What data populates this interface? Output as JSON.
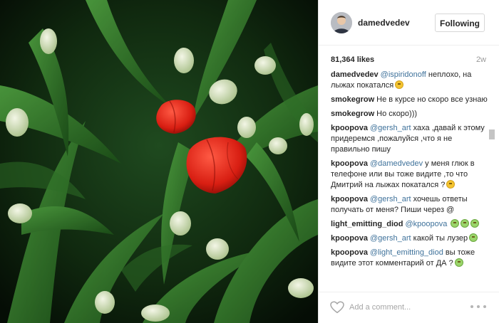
{
  "post": {
    "username": "damedvedev",
    "follow_label": "Following",
    "likes": "81,364 likes",
    "age": "2w",
    "add_comment_placeholder": "Add a comment...",
    "photo_icon": "tulips-photo",
    "avatar_icon": "user-avatar"
  },
  "comments": [
    {
      "author": "damedvedev",
      "mention": "@ispiridonoff",
      "text": " неплохо, на лыжах покатался",
      "emoji": "grin-emoji"
    },
    {
      "author": "smokegrow",
      "mention": "",
      "text": "Не в курсе но скоро все узнаю",
      "emoji": ""
    },
    {
      "author": "smokegrow",
      "mention": "",
      "text": "Но скоро)))",
      "emoji": ""
    },
    {
      "author": "kpoopova",
      "mention": "@gersh_art",
      "text": " хаха ,давай к этому придеремся ,пожалуйся ,что я не правильно пишу",
      "emoji": ""
    },
    {
      "author": "kpoopova",
      "mention": "@damedvedev",
      "text": " у меня глюк в телефоне или вы тоже видите ,то что Дмитрий на лыжах покатался ?",
      "emoji": "grin-emoji"
    },
    {
      "author": "kpoopova",
      "mention": "@gersh_art",
      "text": " хочешь ответы получать от меня? Пиши через @",
      "emoji": ""
    },
    {
      "author": "light_emitting_diod",
      "mention": "@kpoopova",
      "text": " ",
      "emoji": "laugh-emoji-triple"
    },
    {
      "author": "kpoopova",
      "mention": "@gersh_art",
      "text": " какой ты лузер",
      "emoji": "laugh-emoji"
    },
    {
      "author": "kpoopova",
      "mention": "@light_emitting_diod",
      "text": " вы тоже видите этот комментарий от ДА ?",
      "emoji": "laugh-emoji"
    }
  ],
  "colors": {
    "mention": "#3f729b",
    "text": "#262626",
    "muted": "#999999",
    "border": "#efefef"
  }
}
